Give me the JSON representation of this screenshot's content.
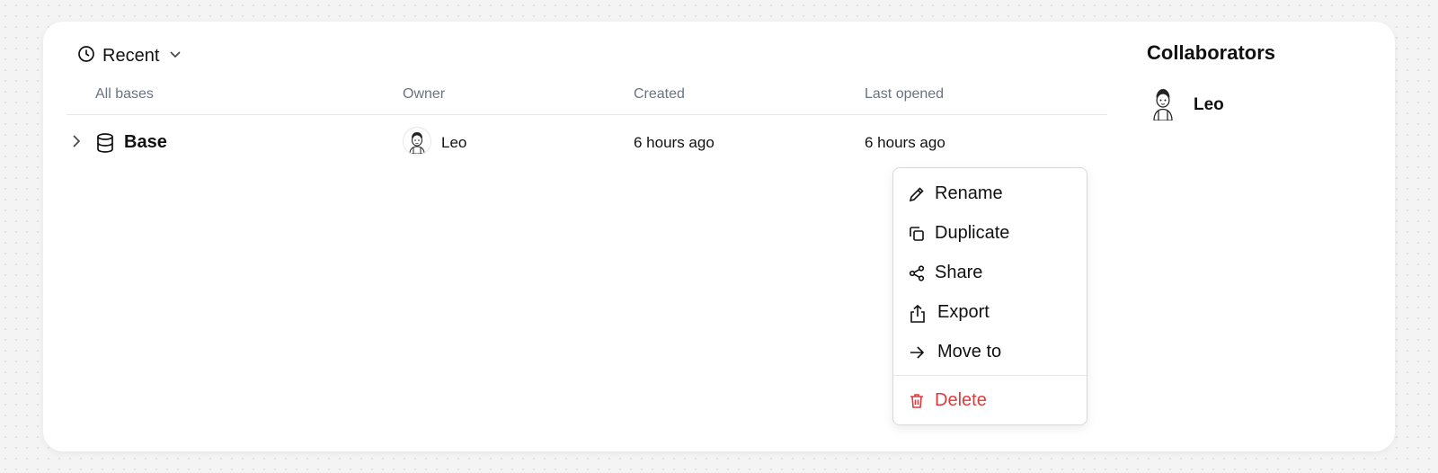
{
  "header": {
    "filter_label": "Recent",
    "filter_icon": "clock-icon",
    "filter_chevron": "chevron-down-icon"
  },
  "table": {
    "columns": [
      "All bases",
      "Owner",
      "Created",
      "Last opened"
    ],
    "rows": [
      {
        "name": "Base",
        "owner": "Leo",
        "created": "6 hours ago",
        "last_opened": "6 hours ago"
      }
    ]
  },
  "collaborators": {
    "title": "Collaborators",
    "people": [
      {
        "name": "Leo"
      }
    ]
  },
  "context_menu": {
    "items": [
      {
        "label": "Rename",
        "icon": "pencil-icon"
      },
      {
        "label": "Duplicate",
        "icon": "copy-icon"
      },
      {
        "label": "Share",
        "icon": "share-icon"
      },
      {
        "label": "Export",
        "icon": "export-icon"
      },
      {
        "label": "Move to",
        "icon": "arrow-right-icon"
      }
    ],
    "danger_item": {
      "label": "Delete",
      "icon": "trash-icon",
      "color": "#dc3c3c"
    }
  }
}
